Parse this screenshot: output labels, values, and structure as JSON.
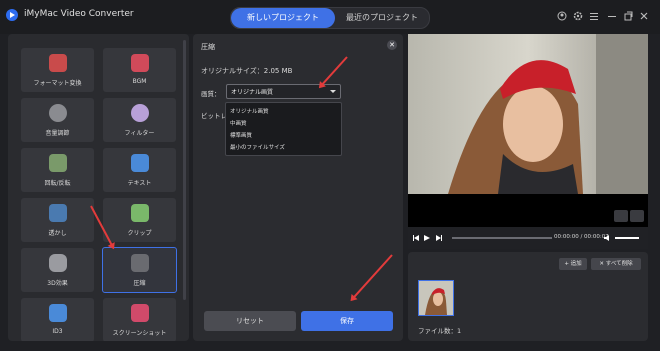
{
  "app": {
    "title": "iMyMac Video Converter"
  },
  "tabs": [
    {
      "label": "新しいプロジェクト"
    },
    {
      "label": "最近のプロジェクト"
    }
  ],
  "tools": [
    {
      "label": "フォーマット変換"
    },
    {
      "label": "BGM"
    },
    {
      "label": "音量調節"
    },
    {
      "label": "フィルター"
    },
    {
      "label": "回転/反転"
    },
    {
      "label": "テキスト"
    },
    {
      "label": "透かし"
    },
    {
      "label": "クリップ"
    },
    {
      "label": "3D効果"
    },
    {
      "label": "圧縮"
    },
    {
      "label": "ID3"
    },
    {
      "label": "スクリーンショット"
    }
  ],
  "dialog": {
    "title": "圧縮",
    "original_size": "オリジナルサイズ：2.05 MB",
    "quality_label": "画質：",
    "quality_value": "オリジナル画質",
    "bitrate_label": "ビットレー",
    "options": [
      "オリジナル画質",
      "中画質",
      "標準画質",
      "最小のファイルサイズ"
    ],
    "reset_label": "リセット",
    "save_label": "保存"
  },
  "player": {
    "time": "00:00:00 / 00:00:07"
  },
  "playlist": {
    "add_label": "追加",
    "delete_all_label": "すべて削除",
    "file_count": "ファイル数：1"
  },
  "colors": {
    "accent": "#3f71e6",
    "arrow": "#e23b3b",
    "background": "#1f2024"
  }
}
